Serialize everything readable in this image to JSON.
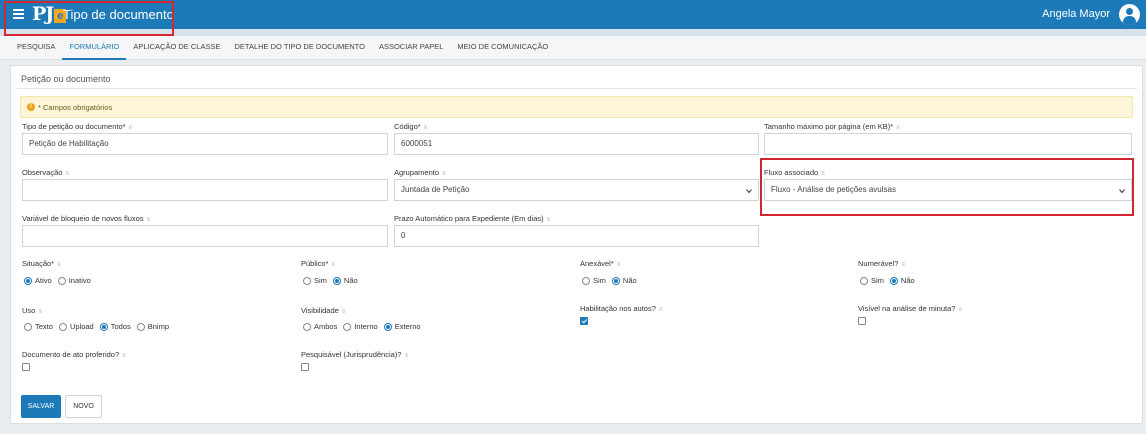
{
  "header": {
    "logo_pj": "PJ",
    "logo_e": "e",
    "title": "Tipo de documento",
    "user": "Angela Mayor"
  },
  "tabs": [
    {
      "label": "PESQUISA",
      "active": false
    },
    {
      "label": "FORMULÁRIO",
      "active": true
    },
    {
      "label": "APLICAÇÃO DE CLASSE",
      "active": false
    },
    {
      "label": "DETALHE DO TIPO DE DOCUMENTO",
      "active": false
    },
    {
      "label": "ASSOCIAR PAPEL",
      "active": false
    },
    {
      "label": "MEIO DE COMUNICAÇÃO",
      "active": false
    }
  ],
  "form": {
    "title": "Petição ou documento",
    "required_notice": "* Campos obrigatórios",
    "hint": "≡",
    "tipo": {
      "label": "Tipo de petição ou documento*",
      "value": "Petição de Habilitação"
    },
    "codigo": {
      "label": "Código*",
      "value": "6000051"
    },
    "tamanho": {
      "label": "Tamanho máximo por página (em KB)*",
      "value": ""
    },
    "observacao": {
      "label": "Observação",
      "value": ""
    },
    "agrupamento": {
      "label": "Agrupamento",
      "value": "Juntada de Petição"
    },
    "fluxo": {
      "label": "Fluxo associado",
      "value": "Fluxo - Análise de petições avulsas"
    },
    "variavel": {
      "label": "Variável de bloqueio de novos fluxos",
      "value": ""
    },
    "prazo": {
      "label": "Prazo Automático para Expediente (Em dias)",
      "value": "0"
    },
    "situacao": {
      "label": "Situação*",
      "options": [
        "Ativo",
        "Inativo"
      ],
      "selected": 0
    },
    "publico": {
      "label": "Público*",
      "options": [
        "Sim",
        "Não"
      ],
      "selected": 1
    },
    "anexavel": {
      "label": "Anexável*",
      "options": [
        "Sim",
        "Não"
      ],
      "selected": 1
    },
    "numeravel": {
      "label": "Numerável?",
      "options": [
        "Sim",
        "Não"
      ],
      "selected": 1
    },
    "uso": {
      "label": "Uso",
      "options": [
        "Texto",
        "Upload",
        "Todos",
        "Bnimp"
      ],
      "selected": 2
    },
    "visibilidade": {
      "label": "Visibilidade",
      "options": [
        "Ambos",
        "Interno",
        "Externo"
      ],
      "selected": 2
    },
    "habilitacao": {
      "label": "Habilitação nos autos?",
      "checked": true
    },
    "visivel": {
      "label": "Visível na análise de minuta?",
      "checked": false
    },
    "ato": {
      "label": "Documento de ato proferido?",
      "checked": false
    },
    "pesquisavel": {
      "label": "Pesquisável (Jurisprudência)?",
      "checked": false
    }
  },
  "buttons": {
    "save": "SALVAR",
    "new": "NOVO"
  },
  "colors": {
    "primary": "#1d7ab8",
    "highlight": "#d4262e",
    "alert_bg": "#fcf5d8"
  }
}
